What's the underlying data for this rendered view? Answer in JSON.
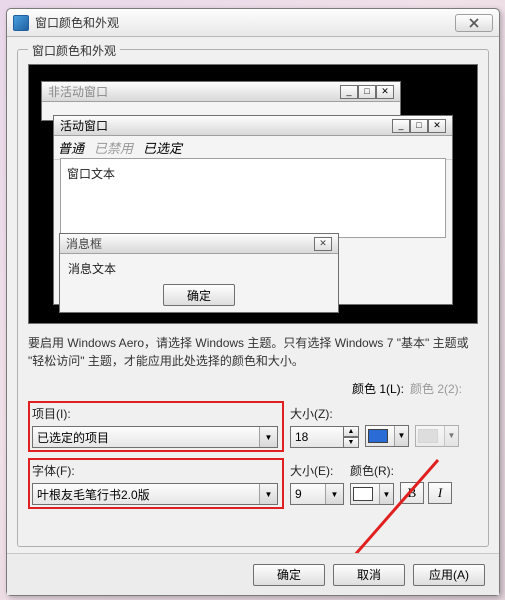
{
  "titlebar": {
    "title": "窗口颜色和外观"
  },
  "group": {
    "legend": "窗口颜色和外观"
  },
  "preview": {
    "inactive_title": "非活动窗口",
    "active_title": "活动窗口",
    "menu_normal": "普通",
    "menu_disabled": "已禁用",
    "menu_selected": "已选定",
    "window_text": "窗口文本",
    "message_box_title": "消息框",
    "message_text": "消息文本",
    "ok_label": "确定"
  },
  "description": "要启用 Windows Aero，请选择 Windows 主题。只有选择 Windows 7 \"基本\" 主题或 \"轻松访问\" 主题，才能应用此处选择的颜色和大小。",
  "labels": {
    "item": "项目(I):",
    "size": "大小(Z):",
    "color1": "颜色 1(L):",
    "color2": "颜色 2(2):",
    "font": "字体(F):",
    "font_size": "大小(E):",
    "font_color": "颜色(R):"
  },
  "values": {
    "item_selected": "已选定的项目",
    "size_value": "18",
    "font_selected": "叶根友毛笔行书2.0版",
    "font_size_value": "9",
    "color1_swatch": "#2a6bd6",
    "font_color_swatch": "#ffffff"
  },
  "buttons": {
    "bold": "B",
    "italic": "I",
    "ok": "确定",
    "cancel": "取消",
    "apply": "应用(A)"
  }
}
